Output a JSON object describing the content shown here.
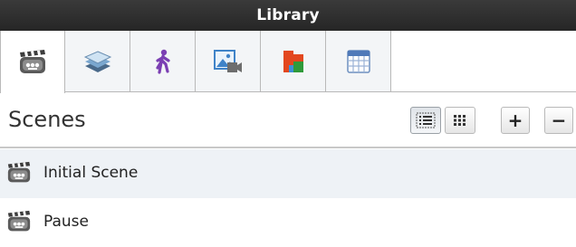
{
  "panel": {
    "title": "Library"
  },
  "tabs": [
    {
      "name": "scenes",
      "icon": "clapperboard-icon",
      "active": true
    },
    {
      "name": "layers",
      "icon": "layers-icon",
      "active": false
    },
    {
      "name": "characters",
      "icon": "walking-person-icon",
      "active": false
    },
    {
      "name": "media",
      "icon": "image-video-icon",
      "active": false
    },
    {
      "name": "puzzle",
      "icon": "puzzle-blocks-icon",
      "active": false
    },
    {
      "name": "table",
      "icon": "table-grid-icon",
      "active": false
    }
  ],
  "section": {
    "title": "Scenes",
    "view_list_icon": "list-view-icon",
    "view_grid_icon": "grid-view-icon",
    "add_label": "+",
    "remove_label": "−"
  },
  "items": [
    {
      "label": "Initial Scene",
      "icon": "clapperboard-icon",
      "selected": true
    },
    {
      "label": "Pause",
      "icon": "clapperboard-icon",
      "selected": false
    }
  ],
  "colors": {
    "titlebar": "#2e2e2e",
    "selected_row": "#eef2f6",
    "tab_inactive": "#f3f5f7"
  }
}
